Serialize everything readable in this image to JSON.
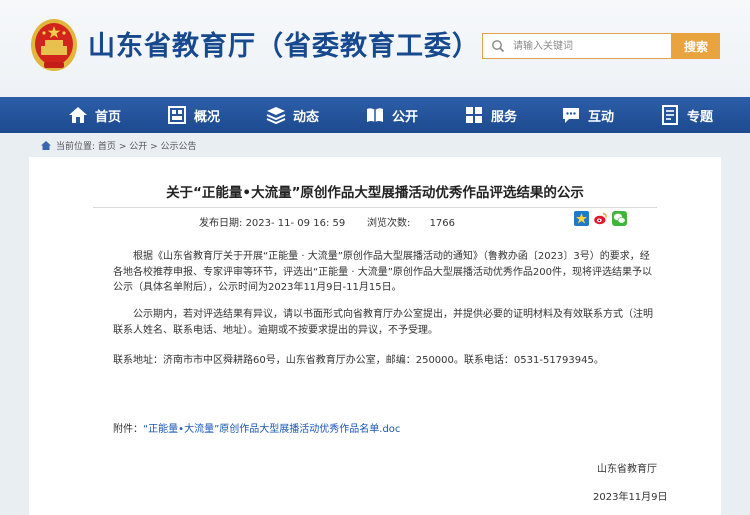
{
  "header": {
    "site_title": "山东省教育厅（省委教育工委）",
    "search": {
      "placeholder": "请输入关键词",
      "button_label": "搜索"
    }
  },
  "nav": {
    "items": [
      {
        "label": "首页",
        "icon": "home-icon"
      },
      {
        "label": "概况",
        "icon": "building-icon"
      },
      {
        "label": "动态",
        "icon": "layers-icon"
      },
      {
        "label": "公开",
        "icon": "book-icon"
      },
      {
        "label": "服务",
        "icon": "grid-icon"
      },
      {
        "label": "互动",
        "icon": "chat-icon"
      },
      {
        "label": "专题",
        "icon": "document-icon"
      }
    ]
  },
  "breadcrumb": {
    "prefix": "当前位置:",
    "items": [
      "首页",
      "公开",
      "公示公告"
    ],
    "separator": " > "
  },
  "article": {
    "title": "关于“正能量•大流量”原创作品大型展播活动优秀作品评选结果的公示",
    "publish_label": "发布日期:",
    "publish_date": "2023- 11- 09 16: 59",
    "views_label": "浏览次数:",
    "views": "1766",
    "share_icons": [
      "star-icon",
      "weibo-icon",
      "wechat-icon"
    ],
    "para1": "根据《山东省教育厅关于开展“正能量 · 大流量”原创作品大型展播活动的通知》（鲁教办函〔2023〕3号）的要求，经各地各校推荐申报、专家评审等环节，评选出“正能量 · 大流量”原创作品大型展播活动优秀作品200件，现将评选结果予以公示（具体名单附后），公示时间为2023年11月9日-11月15日。",
    "para2": "公示期内，若对评选结果有异议，请以书面形式向省教育厅办公室提出，并提供必要的证明材料及有效联系方式（注明联系人姓名、联系电话、地址）。逾期或不按要求提出的异议，不予受理。",
    "contact": "联系地址：济南市市中区舜耕路60号，山东省教育厅办公室，邮编：250000。联系电话：0531-51793945。",
    "attachment_label": "附件：",
    "attachment_link": "“正能量•大流量”原创作品大型展播活动优秀作品名单.doc",
    "signature": "山东省教育厅",
    "sign_date": "2023年11月9日"
  },
  "colors": {
    "brand_blue": "#17498f",
    "nav_blue": "#2359a0",
    "search_orange": "#e9a43f",
    "link_blue": "#1a56b6"
  }
}
